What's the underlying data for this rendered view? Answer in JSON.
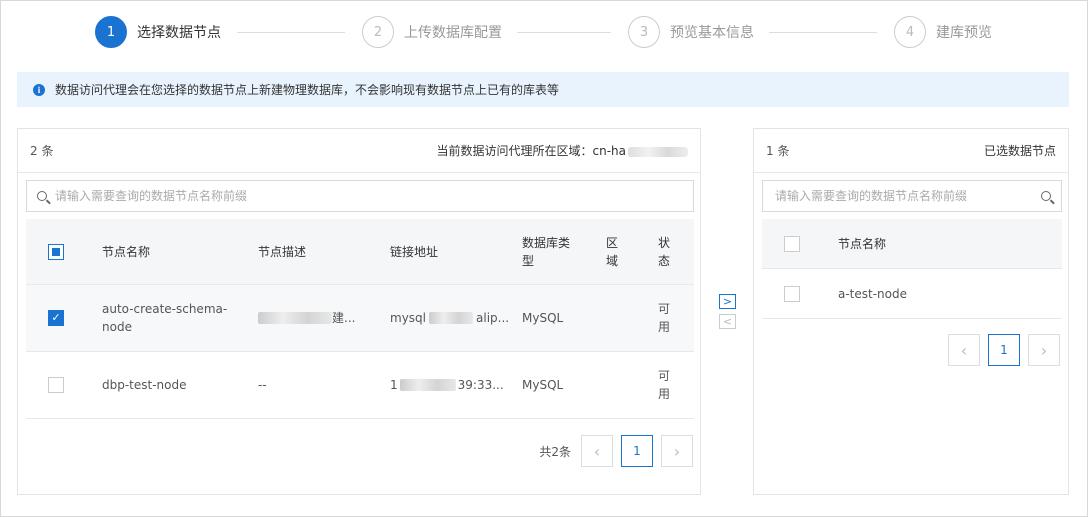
{
  "steps": [
    {
      "num": "1",
      "label": "选择数据节点",
      "active": true
    },
    {
      "num": "2",
      "label": "上传数据库配置",
      "active": false
    },
    {
      "num": "3",
      "label": "预览基本信息",
      "active": false
    },
    {
      "num": "4",
      "label": "建库预览",
      "active": false
    }
  ],
  "notice": {
    "icon": "info-icon",
    "text": "数据访问代理会在您选择的数据节点上新建物理数据库，不会影响现有数据节点上已有的库表等"
  },
  "left": {
    "count": "2 条",
    "region_label": "当前数据访问代理所在区域：cn-ha",
    "search_placeholder": "请输入需要查询的数据节点名称前缀",
    "columns": [
      "节点名称",
      "节点描述",
      "链接地址",
      "数据库类型",
      "区域",
      "状态"
    ],
    "rows": [
      {
        "checked": true,
        "name": "auto-create-schema-node",
        "desc": "建...",
        "addr_prefix": "mysql",
        "addr_suffix": "alip...",
        "type": "MySQL",
        "region": "",
        "status": "可用"
      },
      {
        "checked": false,
        "name": "dbp-test-node",
        "desc": "--",
        "addr_prefix": "1",
        "addr_suffix": "39:33...",
        "type": "MySQL",
        "region": "",
        "status": "可用"
      }
    ],
    "total": "共2条",
    "page": "1"
  },
  "transfer": {
    "right_arrow": ">",
    "left_arrow": "<"
  },
  "right": {
    "count": "1 条",
    "title": "已选数据节点",
    "search_placeholder": "请输入需要查询的数据节点名称前缀",
    "column": "节点名称",
    "rows": [
      {
        "name": "a-test-node"
      }
    ],
    "page": "1"
  },
  "colors": {
    "accent": "#1a73d1",
    "notice_bg": "#e9f3fd"
  }
}
